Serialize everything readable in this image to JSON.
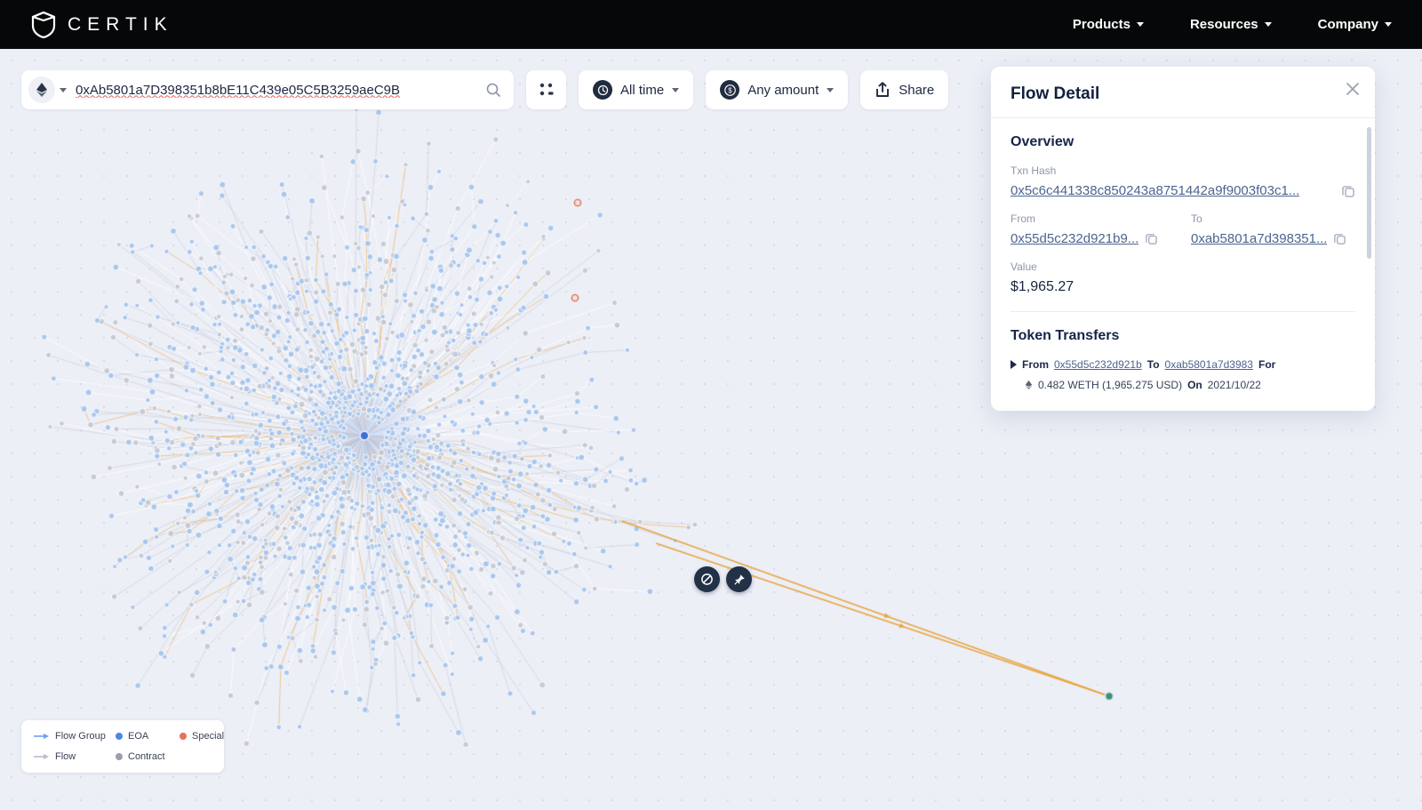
{
  "navbar": {
    "brand": "CERTIK",
    "menus": [
      {
        "label": "Products"
      },
      {
        "label": "Resources"
      },
      {
        "label": "Company"
      }
    ]
  },
  "toolbar": {
    "search_value": "0xAb5801a7D398351b8bE11C439e05C5B3259aeC9B",
    "time_filter": "All time",
    "amount_filter": "Any amount",
    "share_label": "Share"
  },
  "flow_detail": {
    "title": "Flow Detail",
    "overview_heading": "Overview",
    "txn_hash_label": "Txn Hash",
    "txn_hash": "0x5c6c441338c850243a8751442a9f9003f03c1...",
    "from_label": "From",
    "from_value": "0x55d5c232d921b9...",
    "to_label": "To",
    "to_value": "0xab5801a7d398351...",
    "value_label": "Value",
    "value": "$1,965.27",
    "token_transfers_heading": "Token Transfers",
    "transfer": {
      "from_label": "From",
      "from": "0x55d5c232d921b",
      "to_label": "To",
      "to": "0xab5801a7d3983",
      "for_label": "For",
      "amount": "0.482 WETH (1,965.275 USD)",
      "on_label": "On",
      "date": "2021/10/22"
    }
  },
  "legend": {
    "flow_group": "Flow Group",
    "flow": "Flow",
    "eoa": "EOA",
    "contract": "Contract",
    "special": "Special"
  },
  "graph": {
    "colors": {
      "eoa": "#a9c6ec",
      "contract": "#c6cad4",
      "special": "#dd6b52",
      "special_fill": "#f7e2dc",
      "center": "#3b6fd8",
      "flow_line": "#e8a33c",
      "flow_line_soft": "rgba(236,178,90,0.85)",
      "line_gray": "rgba(201,206,218,0.85)",
      "line_white": "rgba(255,255,255,0.9)",
      "far_node": "#3a8f7d"
    }
  }
}
